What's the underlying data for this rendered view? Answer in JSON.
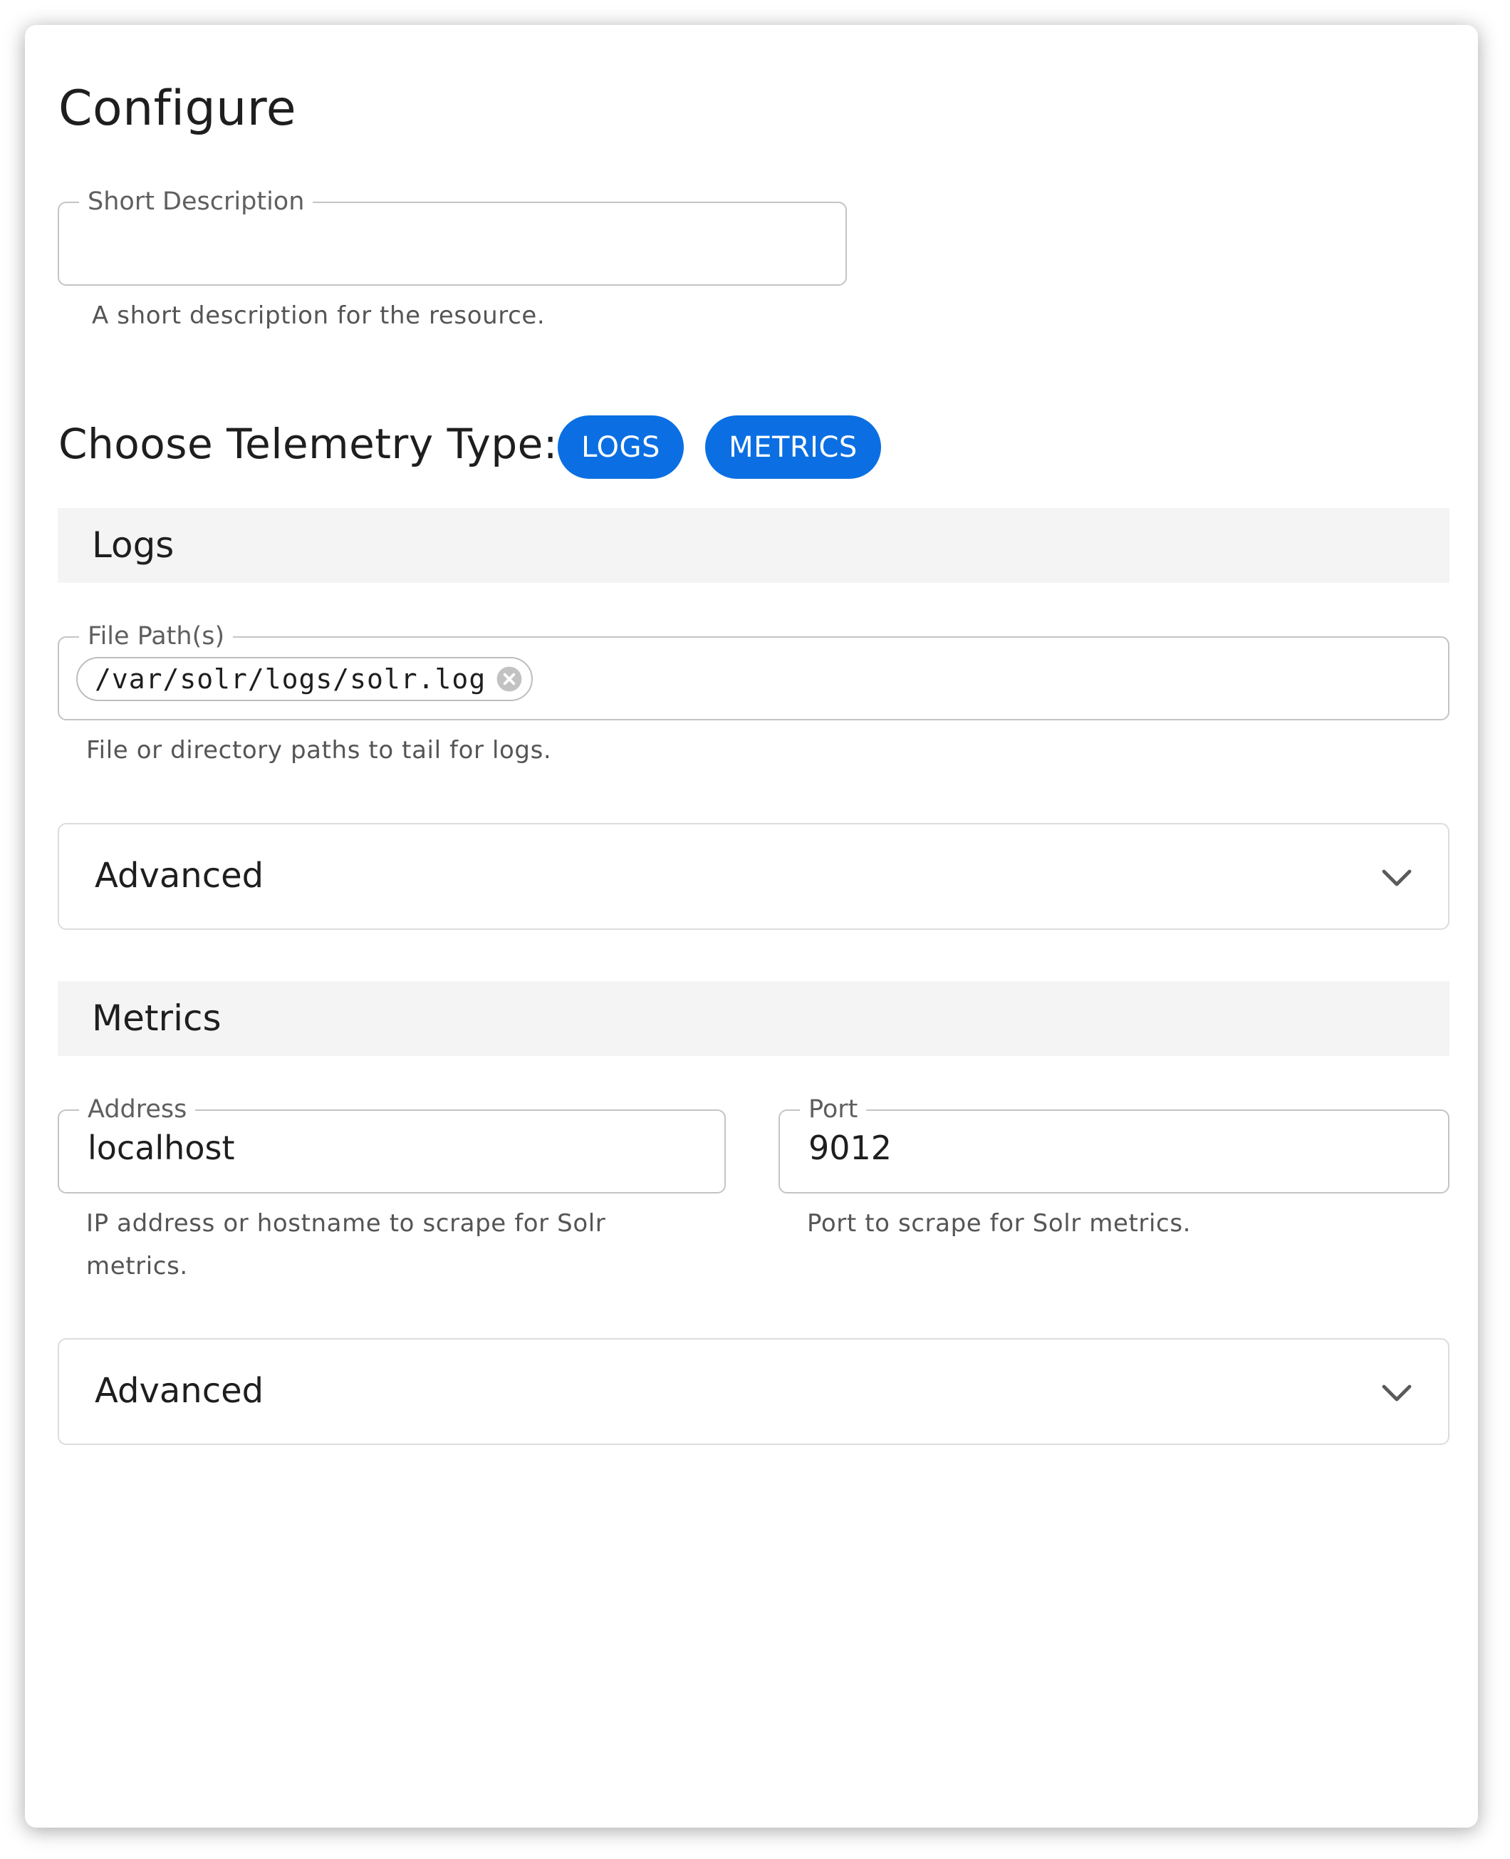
{
  "page": {
    "title": "Configure"
  },
  "short_description": {
    "label": "Short Description",
    "value": "",
    "helper": "A short description for the resource."
  },
  "telemetry": {
    "label": "Choose Telemetry Type:",
    "options": [
      "LOGS",
      "METRICS"
    ],
    "accent_color": "#0b6fe3"
  },
  "logs_section": {
    "header": "Logs",
    "file_paths": {
      "label": "File Path(s)",
      "chips": [
        "/var/solr/logs/solr.log"
      ],
      "helper": "File or directory paths to tail for logs."
    },
    "advanced": {
      "label": "Advanced",
      "icon": "chevron-down-icon"
    }
  },
  "metrics_section": {
    "header": "Metrics",
    "address": {
      "label": "Address",
      "value": "localhost",
      "helper_line1": "IP address or hostname to scrape for Solr",
      "helper_line2": "metrics."
    },
    "port": {
      "label": "Port",
      "value": "9012",
      "helper": "Port to scrape for Solr metrics."
    },
    "advanced": {
      "label": "Advanced",
      "icon": "chevron-down-icon"
    }
  }
}
